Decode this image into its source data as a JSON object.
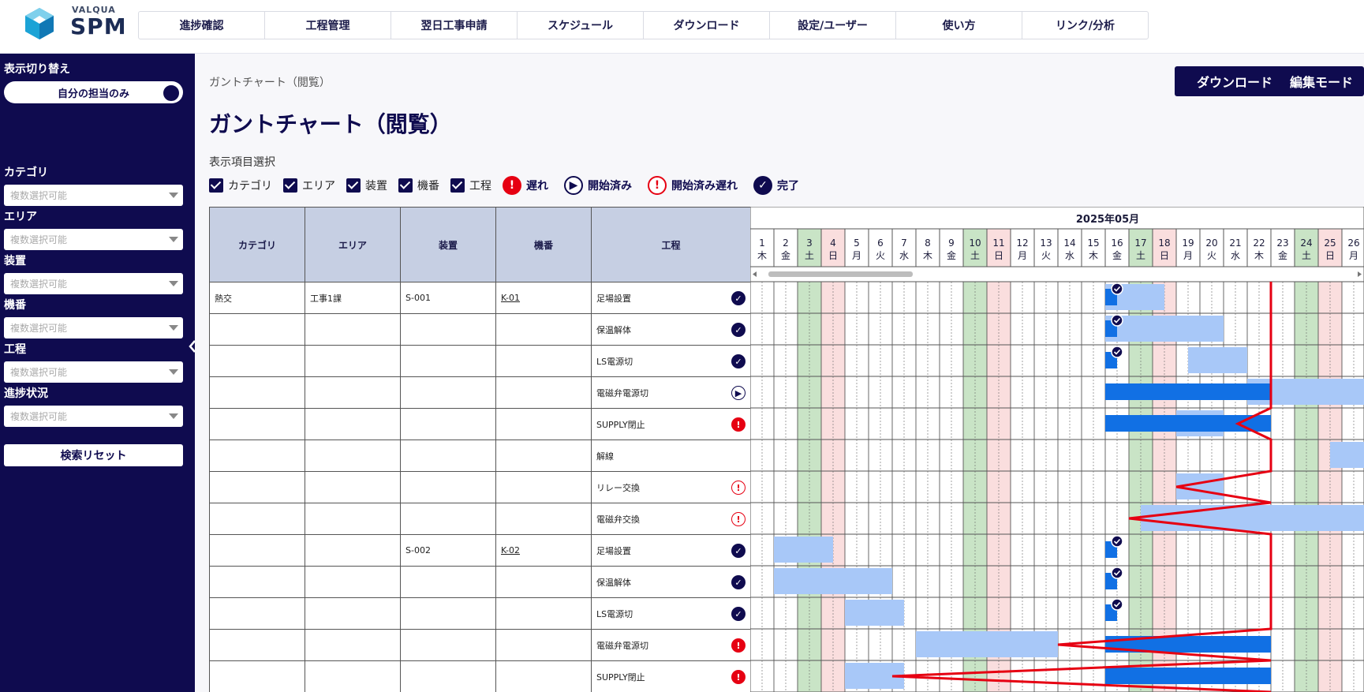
{
  "app": {
    "brand": "VALQUA",
    "product": "SPM"
  },
  "nav": [
    "進捗確認",
    "工程管理",
    "翌日工事申請",
    "スケジュール",
    "ダウンロード",
    "設定/ユーザー",
    "使い方",
    "リンク/分析"
  ],
  "sidebar": {
    "toggle_title": "表示切り替え",
    "toggle_label": "自分の担当のみ",
    "filters": [
      {
        "label": "カテゴリ",
        "placeholder": "複数選択可能"
      },
      {
        "label": "エリア",
        "placeholder": "複数選択可能"
      },
      {
        "label": "装置",
        "placeholder": "複数選択可能"
      },
      {
        "label": "機番",
        "placeholder": "複数選択可能"
      },
      {
        "label": "工程",
        "placeholder": "複数選択可能"
      },
      {
        "label": "進捗状況",
        "placeholder": "複数選択可能"
      }
    ],
    "reset_label": "検索リセット"
  },
  "page": {
    "breadcrumb": "ガントチャート（閲覧）",
    "title": "ガントチャート（閲覧）",
    "download_label": "ダウンロード",
    "edit_label": "編集モード",
    "display_items_label": "表示項目選択",
    "checkboxes": [
      "カテゴリ",
      "エリア",
      "装置",
      "機番",
      "工程"
    ],
    "legend": [
      {
        "label": "遅れ",
        "icon": "late-icon",
        "glyph": "!"
      },
      {
        "label": "開始済み",
        "icon": "started-icon",
        "glyph": "▶"
      },
      {
        "label": "開始済み遅れ",
        "icon": "started-late-icon",
        "glyph": "!"
      },
      {
        "label": "完了",
        "icon": "done-icon",
        "glyph": "✓"
      }
    ]
  },
  "table": {
    "headers": [
      "カテゴリ",
      "エリア",
      "装置",
      "機番",
      "工程"
    ],
    "rows": [
      {
        "category": "熱交",
        "area": "工事1課",
        "device": "S-001",
        "machine": "K-01",
        "process": "足場設置",
        "status": "done",
        "glyph": "✓"
      },
      {
        "category": "",
        "area": "",
        "device": "",
        "machine": "",
        "process": "保温解体",
        "status": "done",
        "glyph": "✓"
      },
      {
        "category": "",
        "area": "",
        "device": "",
        "machine": "",
        "process": "LS電源切",
        "status": "done",
        "glyph": "✓"
      },
      {
        "category": "",
        "area": "",
        "device": "",
        "machine": "",
        "process": "電磁弁電源切",
        "status": "started",
        "glyph": "▶"
      },
      {
        "category": "",
        "area": "",
        "device": "",
        "machine": "",
        "process": "SUPPLY閉止",
        "status": "late",
        "glyph": "!"
      },
      {
        "category": "",
        "area": "",
        "device": "",
        "machine": "",
        "process": "解線",
        "status": "none",
        "glyph": ""
      },
      {
        "category": "",
        "area": "",
        "device": "",
        "machine": "",
        "process": "リレー交換",
        "status": "startlate",
        "glyph": "!"
      },
      {
        "category": "",
        "area": "",
        "device": "",
        "machine": "",
        "process": "電磁弁交換",
        "status": "startlate",
        "glyph": "!"
      },
      {
        "category": "",
        "area": "",
        "device": "S-002",
        "machine": "K-02",
        "process": "足場設置",
        "status": "done",
        "glyph": "✓"
      },
      {
        "category": "",
        "area": "",
        "device": "",
        "machine": "",
        "process": "保温解体",
        "status": "done",
        "glyph": "✓"
      },
      {
        "category": "",
        "area": "",
        "device": "",
        "machine": "",
        "process": "LS電源切",
        "status": "done",
        "glyph": "✓"
      },
      {
        "category": "",
        "area": "",
        "device": "",
        "machine": "",
        "process": "電磁弁電源切",
        "status": "late",
        "glyph": "!"
      },
      {
        "category": "",
        "area": "",
        "device": "",
        "machine": "",
        "process": "SUPPLY閉止",
        "status": "late",
        "glyph": "!"
      }
    ]
  },
  "gantt": {
    "month": "2025年05月",
    "days": [
      {
        "d": "1",
        "w": "木"
      },
      {
        "d": "2",
        "w": "金"
      },
      {
        "d": "3",
        "w": "土"
      },
      {
        "d": "4",
        "w": "日"
      },
      {
        "d": "5",
        "w": "月"
      },
      {
        "d": "6",
        "w": "火"
      },
      {
        "d": "7",
        "w": "水"
      },
      {
        "d": "8",
        "w": "木"
      },
      {
        "d": "9",
        "w": "金"
      },
      {
        "d": "10",
        "w": "土"
      },
      {
        "d": "11",
        "w": "日"
      },
      {
        "d": "12",
        "w": "月"
      },
      {
        "d": "13",
        "w": "火"
      },
      {
        "d": "14",
        "w": "水"
      },
      {
        "d": "15",
        "w": "木"
      },
      {
        "d": "16",
        "w": "金"
      },
      {
        "d": "17",
        "w": "土"
      },
      {
        "d": "18",
        "w": "日"
      },
      {
        "d": "19",
        "w": "月"
      },
      {
        "d": "20",
        "w": "火"
      },
      {
        "d": "21",
        "w": "水"
      },
      {
        "d": "22",
        "w": "木"
      },
      {
        "d": "23",
        "w": "金"
      },
      {
        "d": "24",
        "w": "土"
      },
      {
        "d": "25",
        "w": "日"
      },
      {
        "d": "26",
        "w": "月"
      }
    ],
    "today": 22,
    "colors": {
      "plan": "#a8c8f8",
      "actual": "#1170e4",
      "saturday": "#c9e4c6",
      "sunday": "#fadede",
      "progress_line": "#e60012",
      "done_badge": "#0f0b4f"
    },
    "bars": [
      {
        "row": 0,
        "plan": [
          16,
          18.5
        ],
        "actual": [
          16,
          16.5
        ],
        "done": true
      },
      {
        "row": 1,
        "plan": [
          16,
          21
        ],
        "actual": [
          16,
          16.5
        ],
        "done": true
      },
      {
        "row": 2,
        "plan": [
          19.5,
          22
        ],
        "actual": [
          16,
          16.5
        ],
        "done": true
      },
      {
        "row": 3,
        "plan": [
          22,
          27
        ],
        "actual": [
          16,
          23
        ]
      },
      {
        "row": 4,
        "plan": [
          19,
          21
        ],
        "actual": [
          16,
          23
        ]
      },
      {
        "row": 5,
        "plan": [
          25.5,
          27
        ]
      },
      {
        "row": 6,
        "plan": [
          19,
          21
        ]
      },
      {
        "row": 7,
        "plan": [
          17.5,
          27
        ]
      },
      {
        "row": 8,
        "plan": [
          2,
          4.5
        ],
        "actual": [
          16,
          16.5
        ],
        "done": true
      },
      {
        "row": 9,
        "plan": [
          2,
          7
        ],
        "actual": [
          16,
          16.5
        ],
        "done": true
      },
      {
        "row": 10,
        "plan": [
          5,
          7.5
        ],
        "actual": [
          16,
          16.5
        ],
        "done": true
      },
      {
        "row": 11,
        "plan": [
          8,
          14
        ],
        "actual": [
          16,
          23
        ]
      },
      {
        "row": 12,
        "plan": [
          5,
          7.5
        ],
        "actual": [
          16,
          23
        ]
      }
    ],
    "progress_line": [
      [
        23,
        0
      ],
      [
        23,
        3.5
      ],
      [
        23,
        4.0
      ],
      [
        21.6,
        4.5
      ],
      [
        23,
        5.0
      ],
      [
        23,
        6.0
      ],
      [
        19,
        6.5
      ],
      [
        23,
        7.0
      ],
      [
        17,
        7.5
      ],
      [
        23,
        8.0
      ],
      [
        23,
        11.0
      ],
      [
        14,
        11.5
      ],
      [
        23,
        12.0
      ],
      [
        7,
        12.5
      ],
      [
        23,
        13.0
      ]
    ]
  }
}
